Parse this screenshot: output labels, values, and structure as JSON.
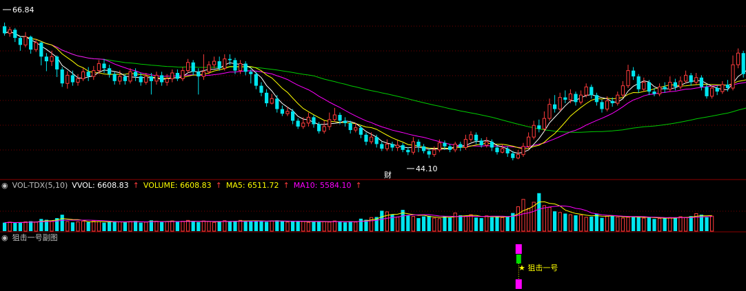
{
  "colors": {
    "background": "#000000",
    "up": "#ff3c3c",
    "down": "#00e5ee",
    "ma_white": "#ffffff",
    "ma_yellow": "#ffff00",
    "ma_magenta": "#ff00ff",
    "ma_green": "#00cc00",
    "grid": "#7a0000",
    "divider": "#8b0000"
  },
  "main": {
    "top_price_label": "66.84",
    "low_price_label": "44.10",
    "finance_marker": "财",
    "price_range": [
      40.5,
      70.0
    ]
  },
  "volume_panel": {
    "indicator": "VOL-TDX(5,10)",
    "vvol": "VVOL: 6608.83",
    "volume": "VOLUME: 6608.83",
    "ma5": "MA5: 6511.72",
    "ma10": "MA10: 5584.10",
    "arrow": "↑"
  },
  "signal_panel": {
    "title": "狙击一号副图",
    "signal_label": "★ 狙击一号"
  },
  "chart_data": {
    "type": "candlestick",
    "price_labels": [
      "66.84",
      "44.10"
    ],
    "candles": [
      [
        66.2,
        65.0,
        66.84,
        64.6
      ],
      [
        65.0,
        65.6,
        66.1,
        64.4
      ],
      [
        65.6,
        64.2,
        65.9,
        63.5
      ],
      [
        64.2,
        63.0,
        64.5,
        62.0
      ],
      [
        63.0,
        64.4,
        65.2,
        62.6
      ],
      [
        64.4,
        62.2,
        64.6,
        61.5
      ],
      [
        62.2,
        63.4,
        64.0,
        61.8
      ],
      [
        63.4,
        61.0,
        63.6,
        59.5
      ],
      [
        61.0,
        60.2,
        61.6,
        58.5
      ],
      [
        60.2,
        61.0,
        62.0,
        59.4
      ],
      [
        61.0,
        58.8,
        61.2,
        57.5
      ],
      [
        58.8,
        56.4,
        59.2,
        55.8
      ],
      [
        56.4,
        57.8,
        58.5,
        55.5
      ],
      [
        57.8,
        56.6,
        58.6,
        56.0
      ],
      [
        56.6,
        57.2,
        58.0,
        56.0
      ],
      [
        57.2,
        58.4,
        59.0,
        56.8
      ],
      [
        58.4,
        57.6,
        59.2,
        56.8
      ],
      [
        57.6,
        58.6,
        59.4,
        57.0
      ],
      [
        58.6,
        59.8,
        60.4,
        58.0
      ],
      [
        59.8,
        59.0,
        60.6,
        58.2
      ],
      [
        59.0,
        58.0,
        59.6,
        57.4
      ],
      [
        58.0,
        56.8,
        58.4,
        56.2
      ],
      [
        56.8,
        57.6,
        58.6,
        56.2
      ],
      [
        57.6,
        56.8,
        58.0,
        56.2
      ],
      [
        56.8,
        58.4,
        59.0,
        56.4
      ],
      [
        58.4,
        57.6,
        59.0,
        56.8
      ],
      [
        57.6,
        56.6,
        58.2,
        56.0
      ],
      [
        56.6,
        57.6,
        58.2,
        56.2
      ],
      [
        57.6,
        56.8,
        58.2,
        54.5
      ],
      [
        56.8,
        57.8,
        58.4,
        56.2
      ],
      [
        57.8,
        56.6,
        58.4,
        56.0
      ],
      [
        56.6,
        57.2,
        58.0,
        56.0
      ],
      [
        57.2,
        58.2,
        58.8,
        56.6
      ],
      [
        58.2,
        57.2,
        58.8,
        56.8
      ],
      [
        57.2,
        58.6,
        59.2,
        56.8
      ],
      [
        58.6,
        60.0,
        60.6,
        58.2
      ],
      [
        60.0,
        58.4,
        60.4,
        57.8
      ],
      [
        58.4,
        57.6,
        59.0,
        54.5
      ],
      [
        57.6,
        58.4,
        61.4,
        57.0
      ],
      [
        58.4,
        59.6,
        60.2,
        58.0
      ],
      [
        59.6,
        60.2,
        61.0,
        59.0
      ],
      [
        60.2,
        59.0,
        61.0,
        58.6
      ],
      [
        59.0,
        60.6,
        61.4,
        58.6
      ],
      [
        60.6,
        60.4,
        61.4,
        59.6
      ],
      [
        60.4,
        58.6,
        60.8,
        58.0
      ],
      [
        58.6,
        59.8,
        60.4,
        58.0
      ],
      [
        59.8,
        58.4,
        60.2,
        57.8
      ],
      [
        58.4,
        58.0,
        58.8,
        56.4
      ],
      [
        58.0,
        56.0,
        58.4,
        55.4
      ],
      [
        56.0,
        54.8,
        56.6,
        54.2
      ],
      [
        54.8,
        53.0,
        55.4,
        52.4
      ],
      [
        53.0,
        53.8,
        54.6,
        52.8
      ],
      [
        53.8,
        52.0,
        54.4,
        51.4
      ],
      [
        52.0,
        51.2,
        52.6,
        50.8
      ],
      [
        51.2,
        51.6,
        52.4,
        50.8
      ],
      [
        51.6,
        50.0,
        52.0,
        49.4
      ],
      [
        50.0,
        49.0,
        50.4,
        48.6
      ],
      [
        49.0,
        49.6,
        50.6,
        48.6
      ],
      [
        49.6,
        50.6,
        51.4,
        49.0
      ],
      [
        50.6,
        49.4,
        51.0,
        48.8
      ],
      [
        49.4,
        48.2,
        49.8,
        47.8
      ],
      [
        48.2,
        49.0,
        50.0,
        47.8
      ],
      [
        49.0,
        50.2,
        51.4,
        48.4
      ],
      [
        50.2,
        51.0,
        52.2,
        49.8
      ],
      [
        51.0,
        50.0,
        51.4,
        49.4
      ],
      [
        50.0,
        49.6,
        50.6,
        49.0
      ],
      [
        49.6,
        48.4,
        50.0,
        47.8
      ],
      [
        48.4,
        48.8,
        49.6,
        48.0
      ],
      [
        48.8,
        47.6,
        49.2,
        47.0
      ],
      [
        47.6,
        46.4,
        48.0,
        45.8
      ],
      [
        46.4,
        47.2,
        48.0,
        46.0
      ],
      [
        47.2,
        46.0,
        47.6,
        45.4
      ],
      [
        46.0,
        45.2,
        46.4,
        44.8
      ],
      [
        45.2,
        46.0,
        46.8,
        44.8
      ],
      [
        46.0,
        45.4,
        46.4,
        44.8
      ],
      [
        45.4,
        45.8,
        46.6,
        44.8
      ],
      [
        45.8,
        45.0,
        46.2,
        44.6
      ],
      [
        45.0,
        44.6,
        45.4,
        44.1
      ],
      [
        44.6,
        46.4,
        47.2,
        44.2
      ],
      [
        46.4,
        45.6,
        46.8,
        44.6
      ],
      [
        45.6,
        44.8,
        46.0,
        44.4
      ],
      [
        44.8,
        44.2,
        45.2,
        43.6
      ],
      [
        44.2,
        45.0,
        45.6,
        43.8
      ],
      [
        45.0,
        46.2,
        46.8,
        44.6
      ],
      [
        46.2,
        45.6,
        46.6,
        45.0
      ],
      [
        45.6,
        45.0,
        46.0,
        44.6
      ],
      [
        45.0,
        46.0,
        46.4,
        44.6
      ],
      [
        46.0,
        45.4,
        46.4,
        44.8
      ],
      [
        45.4,
        46.8,
        47.6,
        45.0
      ],
      [
        46.8,
        47.6,
        48.2,
        46.4
      ],
      [
        47.6,
        46.6,
        48.0,
        46.0
      ],
      [
        46.6,
        45.8,
        47.0,
        45.4
      ],
      [
        45.8,
        46.4,
        47.2,
        45.4
      ],
      [
        46.4,
        45.4,
        46.8,
        44.8
      ],
      [
        45.4,
        44.6,
        45.8,
        44.2
      ],
      [
        44.6,
        45.2,
        46.0,
        44.4
      ],
      [
        45.2,
        44.4,
        45.6,
        43.8
      ],
      [
        44.4,
        43.6,
        44.8,
        43.2
      ],
      [
        43.6,
        44.2,
        45.0,
        43.4
      ],
      [
        44.2,
        45.6,
        46.2,
        43.8
      ],
      [
        45.6,
        47.2,
        48.0,
        45.2
      ],
      [
        47.2,
        49.2,
        50.0,
        46.8
      ],
      [
        49.2,
        48.6,
        50.2,
        48.0
      ],
      [
        48.6,
        50.4,
        51.6,
        48.2
      ],
      [
        50.4,
        52.8,
        53.8,
        50.0
      ],
      [
        52.8,
        52.0,
        54.4,
        51.4
      ],
      [
        52.0,
        54.0,
        54.8,
        51.6
      ],
      [
        54.0,
        53.6,
        55.2,
        53.0
      ],
      [
        53.6,
        54.6,
        55.4,
        53.0
      ],
      [
        54.6,
        53.2,
        55.0,
        52.6
      ],
      [
        53.2,
        54.4,
        55.2,
        52.8
      ],
      [
        54.4,
        55.8,
        56.4,
        54.0
      ],
      [
        55.8,
        54.4,
        56.2,
        53.8
      ],
      [
        54.4,
        53.2,
        54.8,
        52.6
      ],
      [
        53.2,
        52.0,
        53.6,
        51.4
      ],
      [
        52.0,
        53.4,
        54.2,
        51.6
      ],
      [
        53.4,
        53.0,
        54.0,
        52.4
      ],
      [
        53.0,
        54.4,
        55.0,
        52.6
      ],
      [
        54.4,
        56.0,
        56.8,
        54.0
      ],
      [
        56.0,
        58.6,
        59.6,
        55.6
      ],
      [
        58.6,
        57.6,
        59.2,
        57.0
      ],
      [
        57.6,
        55.4,
        58.0,
        54.8
      ],
      [
        55.4,
        56.6,
        57.4,
        55.0
      ],
      [
        56.6,
        55.0,
        57.0,
        54.4
      ],
      [
        55.0,
        54.6,
        55.6,
        54.2
      ],
      [
        54.6,
        55.8,
        56.4,
        54.2
      ],
      [
        55.8,
        55.4,
        56.6,
        54.8
      ],
      [
        55.4,
        56.6,
        57.6,
        55.0
      ],
      [
        56.6,
        55.8,
        57.2,
        55.2
      ],
      [
        55.8,
        56.8,
        57.6,
        55.4
      ],
      [
        56.8,
        57.8,
        58.6,
        56.4
      ],
      [
        57.8,
        56.6,
        58.2,
        56.0
      ],
      [
        56.6,
        57.4,
        58.2,
        56.2
      ],
      [
        57.4,
        55.8,
        57.8,
        55.2
      ],
      [
        55.8,
        54.2,
        56.2,
        53.8
      ],
      [
        54.2,
        55.6,
        56.0,
        53.8
      ],
      [
        55.6,
        55.0,
        56.0,
        54.4
      ],
      [
        55.0,
        56.2,
        56.8,
        54.6
      ],
      [
        56.2,
        55.6,
        57.0,
        55.0
      ],
      [
        55.6,
        59.6,
        61.2,
        55.2
      ],
      [
        59.6,
        61.6,
        62.4,
        59.0
      ],
      [
        61.6,
        58.0,
        62.0,
        57.4
      ],
      [
        58.0,
        59.8,
        61.2,
        56.2
      ]
    ],
    "volume": [
      3.0,
      3.2,
      2.9,
      3.1,
      3.3,
      3.5,
      3.2,
      4.3,
      4.0,
      3.6,
      4.6,
      5.8,
      3.4,
      3.1,
      3.3,
      3.5,
      3.2,
      3.6,
      3.4,
      3.0,
      3.2,
      3.5,
      3.3,
      3.1,
      3.4,
      3.6,
      3.0,
      3.2,
      3.8,
      3.5,
      3.2,
      3.4,
      3.6,
      3.3,
      3.5,
      3.8,
      3.4,
      3.2,
      3.6,
      3.4,
      3.1,
      3.3,
      3.7,
      3.5,
      3.6,
      3.8,
      3.5,
      3.7,
      3.6,
      3.5,
      3.3,
      3.6,
      3.8,
      3.5,
      3.2,
      3.4,
      3.6,
      3.4,
      3.1,
      3.3,
      3.5,
      3.4,
      3.2,
      3.6,
      3.3,
      3.1,
      3.5,
      3.2,
      4.4,
      4.0,
      4.8,
      5.0,
      7.2,
      6.8,
      5.8,
      5.0,
      7.5,
      5.6,
      5.2,
      4.6,
      5.2,
      5.4,
      4.6,
      4.4,
      5.2,
      4.8,
      6.4,
      5.6,
      5.2,
      5.8,
      4.8,
      4.6,
      5.4,
      4.9,
      5.3,
      4.8,
      5.1,
      6.4,
      8.6,
      11.2,
      8.0,
      10.2,
      13.4,
      9.0,
      8.4,
      7.0,
      6.6,
      6.2,
      5.8,
      5.6,
      5.6,
      4.9,
      5.1,
      6.2,
      4.7,
      5.3,
      5.6,
      5.0,
      4.6,
      4.9,
      5.2,
      5.1,
      4.6,
      4.8,
      4.3,
      4.5,
      4.7,
      4.8,
      4.8,
      5.1,
      4.8,
      5.3,
      6.2,
      5.8,
      4.9,
      5.3
    ],
    "signal": {
      "index": 98,
      "label": "★ 狙击一号"
    },
    "ma_periods": {
      "white": 5,
      "yellow": 10,
      "magenta": 20,
      "green": 60
    }
  }
}
